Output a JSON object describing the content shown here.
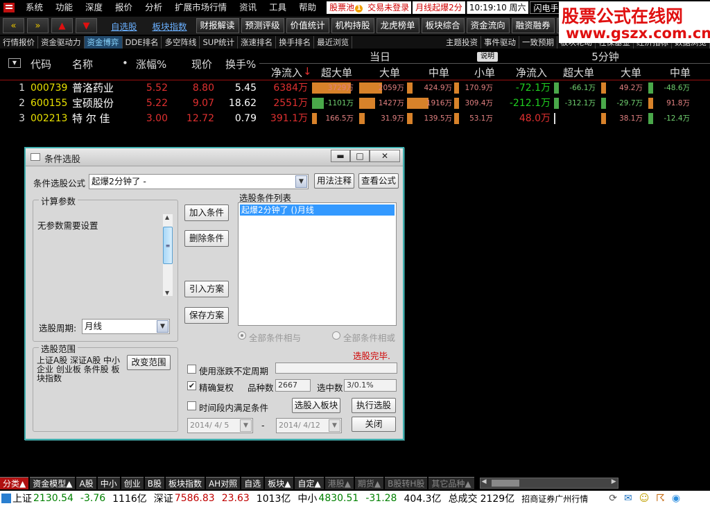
{
  "menu": {
    "items": [
      "系统",
      "功能",
      "深度",
      "报价",
      "分析",
      "扩展市场行情",
      "资讯",
      "工具",
      "帮助"
    ],
    "pool_label": "股票池",
    "pool_badge": "1",
    "trade_status": "交易未登录",
    "monthly_alert": "月线起爆2分",
    "clock": "10:19:10 周六",
    "flash_label": "闪电手",
    "quote_label": "行情"
  },
  "toolbar": {
    "back": "«",
    "forward": "»",
    "up": "▲",
    "down": "▼",
    "links": [
      "自选股",
      "板块指数"
    ],
    "buttons": [
      "财报解读",
      "预测评级",
      "价值统计",
      "机构持股",
      "龙虎榜单",
      "板块综合",
      "资金流向",
      "融资融券",
      "持"
    ]
  },
  "watermark": {
    "line1": "股票公式在线网",
    "line2": "www.gszx.com.cn"
  },
  "subtabs": {
    "left": [
      "行情报价",
      "资金驱动力",
      "资金博弈",
      "DDE排名",
      "多空阵线",
      "SUP统计",
      "涨速排名",
      "换手排名",
      "最近浏览"
    ],
    "active_index": 2,
    "right": [
      "主题投资",
      "事件驱动",
      "一致预期",
      "板块轮动",
      "社保基金",
      "经济指标",
      "数据浏览"
    ]
  },
  "table": {
    "headers": {
      "code": "代码",
      "name": "名称",
      "name_dot": "•",
      "change": "涨幅%",
      "price": "现价",
      "turnover": "换手%",
      "group_today": "当日",
      "explain": "说明",
      "group_5min": "5分钟",
      "net_inflow": "净流入",
      "sort_arrow": "↓",
      "super_large": "超大单",
      "large": "大单",
      "medium": "中单",
      "small": "小单",
      "net_inflow_5": "净流入",
      "super_large_5": "超大单",
      "large_5": "大单",
      "medium_5": "中单"
    },
    "rows": [
      {
        "idx": "1",
        "code": "000739",
        "name": "普洛药业",
        "change": "5.52",
        "price": "8.80",
        "turnover": "5.45",
        "net": "6384万",
        "super": "3729万",
        "large": "2059万",
        "medium": "424.9万",
        "small": "170.9万",
        "net5": "-72.1万",
        "super5": "-66.1万",
        "large5": "49.2万",
        "medium5": "-48.6万"
      },
      {
        "idx": "2",
        "code": "600155",
        "name": "宝硕股份",
        "change": "5.22",
        "price": "9.07",
        "turnover": "18.62",
        "net": "2551万",
        "super": "-1101万",
        "large": "1427万",
        "medium": "1916万",
        "small": "309.4万",
        "net5": "-212.1万",
        "super5": "-312.1万",
        "large5": "-29.7万",
        "medium5": "91.8万"
      },
      {
        "idx": "3",
        "code": "002213",
        "name": "特 尔 佳",
        "change": "3.00",
        "price": "12.72",
        "turnover": "0.79",
        "net": "391.1万",
        "super": "166.5万",
        "large": "31.9万",
        "medium": "139.5万",
        "small": "53.1万",
        "net5": "48.0万",
        "super5": "",
        "large5": "38.1万",
        "medium5": "-12.4万"
      }
    ]
  },
  "dialog": {
    "title": "条件选股",
    "min_btn": "▬",
    "max_btn": "□",
    "close_btn": "✕",
    "formula_label": "条件选股公式",
    "formula_value": "起爆2分钟了 -",
    "usage_btn": "用法注释",
    "view_btn": "查看公式",
    "params_title": "计算参数",
    "params_text": "无参数需要设置",
    "add_btn": "加入条件",
    "delete_btn": "删除条件",
    "import_btn": "引入方案",
    "save_btn": "保存方案",
    "list_title": "选股条件列表",
    "list_items": [
      "起爆2分钟了  ()月线"
    ],
    "period_label": "选股周期:",
    "period_value": "月线",
    "radio_and": "全部条件相与",
    "radio_or": "全部条件相或",
    "result_text": "选股完毕.",
    "range_title": "选股范围",
    "range_text": "上证A股 深证A股 中小企业 创业板 条件股 板块指数",
    "change_range_btn": "改变范围",
    "use_volatile_label": "使用涨跌不定周期",
    "exact_reweight_label": "精确复权",
    "variety_label": "品种数",
    "variety_value": "2667",
    "selected_label": "选中数",
    "selected_value": "3/0.1%",
    "time_range_label": "时间段内满足条件",
    "to_board_btn": "选股入板块",
    "execute_btn": "执行选股",
    "date_from": "2014/ 4/ 5",
    "date_sep": "-",
    "date_to": "2014/ 4/12",
    "close_dialog_btn": "关闭"
  },
  "bottom_tabs": [
    "分类▲",
    "资金模型▲",
    "A股",
    "中小",
    "创业",
    "B股",
    "板块指数",
    "AH对照",
    "自选",
    "板块▲",
    "自定▲",
    "港股▲",
    "期货▲",
    "B股转H股",
    "其它品种▲"
  ],
  "status": {
    "sh_label": "上证",
    "sh_value": "2130.54",
    "sh_change": "-3.76",
    "sh_amount": "1116亿",
    "sz_label": "深证",
    "sz_value": "7586.83",
    "sz_change": "23.63",
    "sz_amount": "1013亿",
    "zx_label": "中小",
    "zx_value": "4830.51",
    "zx_change": "-31.28",
    "zx_amount": "404.3亿",
    "total_label": "总成交",
    "total_value": "2129亿",
    "broker": "招商证券广州行情"
  },
  "colors": {
    "up": "#e03030",
    "down": "#20d020",
    "code": "#e8e000",
    "bar_orange": "#d8822a",
    "bar_green": "#4aa84a",
    "dialog_border": "#40b0b0"
  }
}
